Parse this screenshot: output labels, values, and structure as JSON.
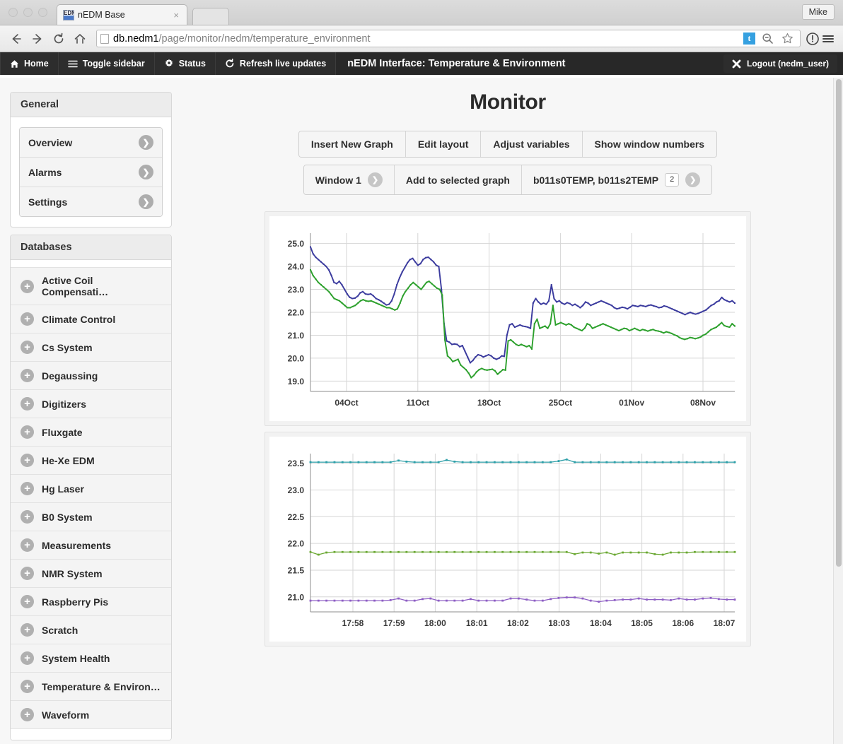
{
  "browser": {
    "tab": {
      "title": "nEDM Base",
      "favicon": "EDM",
      "close_label": "×"
    },
    "profile_button": "Mike",
    "url": {
      "domain": "db.nedm1",
      "path": "/page/monitor/nedm/temperature_environment"
    },
    "url_badge": "t",
    "icons": [
      "back-icon",
      "forward-icon",
      "reload-icon",
      "home-icon",
      "zoom-out-icon",
      "bookmark-star-icon",
      "info-icon",
      "menu-icon"
    ]
  },
  "appnav": {
    "items": [
      {
        "label": "Home",
        "icon": "home-icon"
      },
      {
        "label": "Toggle sidebar",
        "icon": "hamburger-icon"
      },
      {
        "label": "Status",
        "icon": "gear-icon"
      },
      {
        "label": "Refresh live updates",
        "icon": "refresh-icon"
      }
    ],
    "title": "nEDM Interface: Temperature & Environment",
    "logout": {
      "label": "Logout (nedm_user)",
      "icon": "close-x-icon"
    }
  },
  "sidebar": {
    "general": {
      "header": "General",
      "items": [
        {
          "label": "Overview"
        },
        {
          "label": "Alarms"
        },
        {
          "label": "Settings"
        }
      ]
    },
    "databases": {
      "header": "Databases",
      "items": [
        {
          "label": "Active Coil Compensati…"
        },
        {
          "label": "Climate Control"
        },
        {
          "label": "Cs System"
        },
        {
          "label": "Degaussing"
        },
        {
          "label": "Digitizers"
        },
        {
          "label": "Fluxgate"
        },
        {
          "label": "He-Xe EDM"
        },
        {
          "label": "Hg Laser"
        },
        {
          "label": "B0 System"
        },
        {
          "label": "Measurements"
        },
        {
          "label": "NMR System"
        },
        {
          "label": "Raspberry Pis"
        },
        {
          "label": "Scratch"
        },
        {
          "label": "System Health"
        },
        {
          "label": "Temperature & Environ…"
        },
        {
          "label": "Waveform"
        }
      ]
    }
  },
  "main": {
    "title": "Monitor",
    "toolbar": [
      {
        "label": "Insert New Graph"
      },
      {
        "label": "Edit layout"
      },
      {
        "label": "Adjust variables"
      },
      {
        "label": "Show window numbers"
      }
    ],
    "toolbar2": {
      "window_select": "Window 1",
      "add_button": "Add to selected graph",
      "variables": "b011s0TEMP, b011s2TEMP",
      "variables_count": "2"
    }
  },
  "chart_data": [
    {
      "id": "graph1",
      "type": "line",
      "title": "",
      "xlabel": "",
      "ylabel": "",
      "ylim": [
        18.55,
        25.45
      ],
      "yticks": [
        19.0,
        20.0,
        21.0,
        22.0,
        23.0,
        24.0,
        25.0
      ],
      "ytick_labels": [
        "19.0",
        "20.0",
        "21.0",
        "22.0",
        "23.0",
        "24.0",
        "25.0"
      ],
      "xticks": [
        0.085,
        0.253,
        0.421,
        0.589,
        0.757,
        0.925
      ],
      "xtick_labels": [
        "04Oct",
        "11Oct",
        "18Oct",
        "25Oct",
        "01Nov",
        "08Nov"
      ],
      "grid": true,
      "legend": "none",
      "series": [
        {
          "name": "b011s0TEMP",
          "color": "#3b3b9e",
          "values": [
            24.85,
            24.55,
            24.4,
            24.3,
            24.2,
            24.1,
            24.0,
            23.85,
            23.6,
            23.3,
            23.25,
            23.35,
            23.2,
            23.0,
            22.8,
            22.65,
            22.6,
            22.62,
            22.7,
            22.85,
            22.9,
            22.8,
            22.78,
            22.8,
            22.72,
            22.6,
            22.55,
            22.48,
            22.4,
            22.32,
            22.35,
            22.5,
            22.8,
            23.2,
            23.5,
            23.75,
            23.95,
            24.15,
            24.3,
            24.35,
            24.2,
            24.05,
            24.12,
            24.3,
            24.38,
            24.4,
            24.3,
            24.2,
            24.05,
            24.0,
            23.0,
            21.5,
            20.75,
            20.7,
            20.6,
            20.62,
            20.6,
            20.5,
            20.55,
            20.3,
            20.05,
            19.8,
            19.9,
            20.05,
            20.15,
            20.12,
            20.05,
            20.1,
            20.15,
            20.1,
            20.0,
            19.95,
            20.0,
            20.1,
            20.08,
            21.0,
            21.45,
            21.5,
            21.35,
            21.4,
            21.45,
            21.4,
            21.38,
            21.35,
            21.3,
            22.4,
            22.6,
            22.45,
            22.35,
            22.4,
            22.35,
            22.5,
            23.2,
            22.6,
            22.45,
            22.5,
            22.4,
            22.35,
            22.42,
            22.38,
            22.3,
            22.35,
            22.28,
            22.2,
            22.3,
            22.45,
            22.4,
            22.3,
            22.35,
            22.4,
            22.45,
            22.5,
            22.45,
            22.4,
            22.35,
            22.3,
            22.2,
            22.15,
            22.18,
            22.22,
            22.2,
            22.15,
            22.22,
            22.3,
            22.28,
            22.25,
            22.3,
            22.28,
            22.25,
            22.3,
            22.32,
            22.28,
            22.25,
            22.2,
            22.22,
            22.28,
            22.25,
            22.2,
            22.15,
            22.1,
            22.05,
            22.0,
            21.95,
            21.9,
            21.95,
            22.0,
            21.95,
            21.92,
            21.95,
            22.0,
            22.05,
            22.1,
            22.2,
            22.3,
            22.35,
            22.45,
            22.5,
            22.65,
            22.55,
            22.5,
            22.45,
            22.5,
            22.4
          ]
        },
        {
          "name": "b011s2TEMP",
          "color": "#2ca02c",
          "values": [
            23.85,
            23.6,
            23.45,
            23.3,
            23.2,
            23.1,
            23.0,
            22.9,
            22.75,
            22.6,
            22.55,
            22.5,
            22.4,
            22.3,
            22.2,
            22.2,
            22.25,
            22.3,
            22.4,
            22.5,
            22.55,
            22.5,
            22.48,
            22.5,
            22.45,
            22.4,
            22.35,
            22.3,
            22.25,
            22.2,
            22.2,
            22.15,
            22.1,
            22.15,
            22.4,
            22.7,
            22.9,
            23.05,
            23.2,
            23.3,
            23.2,
            23.1,
            23.0,
            23.15,
            23.3,
            23.35,
            23.25,
            23.15,
            23.05,
            23.0,
            22.75,
            20.8,
            20.1,
            20.0,
            19.85,
            19.9,
            19.95,
            19.7,
            19.6,
            19.5,
            19.35,
            19.15,
            19.25,
            19.4,
            19.5,
            19.55,
            19.5,
            19.48,
            19.5,
            19.52,
            19.45,
            19.3,
            19.4,
            19.5,
            19.48,
            20.75,
            20.8,
            20.7,
            20.6,
            20.55,
            20.6,
            20.55,
            20.5,
            20.55,
            20.4,
            21.5,
            21.7,
            21.3,
            21.35,
            21.4,
            21.3,
            21.5,
            22.3,
            21.45,
            21.5,
            21.55,
            21.5,
            21.45,
            21.5,
            21.45,
            21.35,
            21.3,
            21.25,
            21.2,
            21.3,
            21.5,
            21.45,
            21.3,
            21.35,
            21.4,
            21.45,
            21.5,
            21.45,
            21.4,
            21.35,
            21.3,
            21.25,
            21.2,
            21.25,
            21.3,
            21.28,
            21.2,
            21.25,
            21.3,
            21.25,
            21.2,
            21.25,
            21.22,
            21.18,
            21.22,
            21.25,
            21.2,
            21.18,
            21.15,
            21.1,
            21.15,
            21.12,
            21.08,
            21.02,
            20.98,
            20.9,
            20.85,
            20.82,
            20.85,
            20.9,
            20.88,
            20.85,
            20.88,
            20.92,
            21.0,
            21.05,
            21.15,
            21.25,
            21.3,
            21.35,
            21.45,
            21.55,
            21.42,
            21.38,
            21.35,
            21.5,
            21.4
          ]
        }
      ]
    },
    {
      "id": "graph2",
      "type": "line",
      "title": "",
      "xlabel": "",
      "ylabel": "",
      "ylim": [
        20.72,
        23.68
      ],
      "yticks": [
        21.0,
        21.5,
        22.0,
        22.5,
        23.0,
        23.5
      ],
      "ytick_labels": [
        "21.0",
        "21.5",
        "22.0",
        "22.5",
        "23.0",
        "23.5"
      ],
      "xticks": [
        0.1,
        0.197,
        0.294,
        0.392,
        0.489,
        0.586,
        0.684,
        0.781,
        0.878,
        0.975
      ],
      "xtick_labels": [
        "17:58",
        "17:59",
        "18:00",
        "18:01",
        "18:02",
        "18:03",
        "18:04",
        "18:05",
        "18:06",
        "18:07"
      ],
      "grid": true,
      "legend": "none",
      "series": [
        {
          "name": "series-teal",
          "color": "#2d9fa8",
          "values": [
            23.52,
            23.52,
            23.52,
            23.52,
            23.52,
            23.52,
            23.52,
            23.52,
            23.52,
            23.52,
            23.52,
            23.55,
            23.53,
            23.52,
            23.52,
            23.52,
            23.52,
            23.56,
            23.53,
            23.52,
            23.52,
            23.52,
            23.52,
            23.52,
            23.52,
            23.52,
            23.52,
            23.52,
            23.52,
            23.52,
            23.52,
            23.54,
            23.57,
            23.52,
            23.52,
            23.52,
            23.52,
            23.52,
            23.52,
            23.52,
            23.52,
            23.52,
            23.52,
            23.52,
            23.52,
            23.52,
            23.52,
            23.52,
            23.52,
            23.52,
            23.52,
            23.52,
            23.52,
            23.52
          ]
        },
        {
          "name": "series-green",
          "color": "#6aa832",
          "values": [
            21.84,
            21.79,
            21.83,
            21.84,
            21.84,
            21.84,
            21.84,
            21.84,
            21.84,
            21.84,
            21.84,
            21.84,
            21.84,
            21.84,
            21.84,
            21.84,
            21.84,
            21.84,
            21.84,
            21.84,
            21.84,
            21.84,
            21.84,
            21.84,
            21.84,
            21.84,
            21.84,
            21.84,
            21.84,
            21.84,
            21.84,
            21.84,
            21.84,
            21.8,
            21.83,
            21.83,
            21.81,
            21.83,
            21.79,
            21.83,
            21.83,
            21.83,
            21.83,
            21.8,
            21.79,
            21.83,
            21.83,
            21.83,
            21.84,
            21.84,
            21.84,
            21.84,
            21.84,
            21.84
          ]
        },
        {
          "name": "series-purple",
          "color": "#8e5fc4",
          "values": [
            20.93,
            20.93,
            20.93,
            20.93,
            20.93,
            20.93,
            20.93,
            20.93,
            20.93,
            20.93,
            20.94,
            20.97,
            20.93,
            20.93,
            20.96,
            20.97,
            20.93,
            20.93,
            20.93,
            20.93,
            20.96,
            20.93,
            20.93,
            20.93,
            20.93,
            20.97,
            20.97,
            20.95,
            20.93,
            20.93,
            20.96,
            20.98,
            20.99,
            20.99,
            20.97,
            20.93,
            20.91,
            20.93,
            20.94,
            20.95,
            20.95,
            20.97,
            20.95,
            20.95,
            20.95,
            20.94,
            20.97,
            20.95,
            20.95,
            20.97,
            20.98,
            20.96,
            20.95,
            20.95
          ]
        }
      ]
    }
  ]
}
